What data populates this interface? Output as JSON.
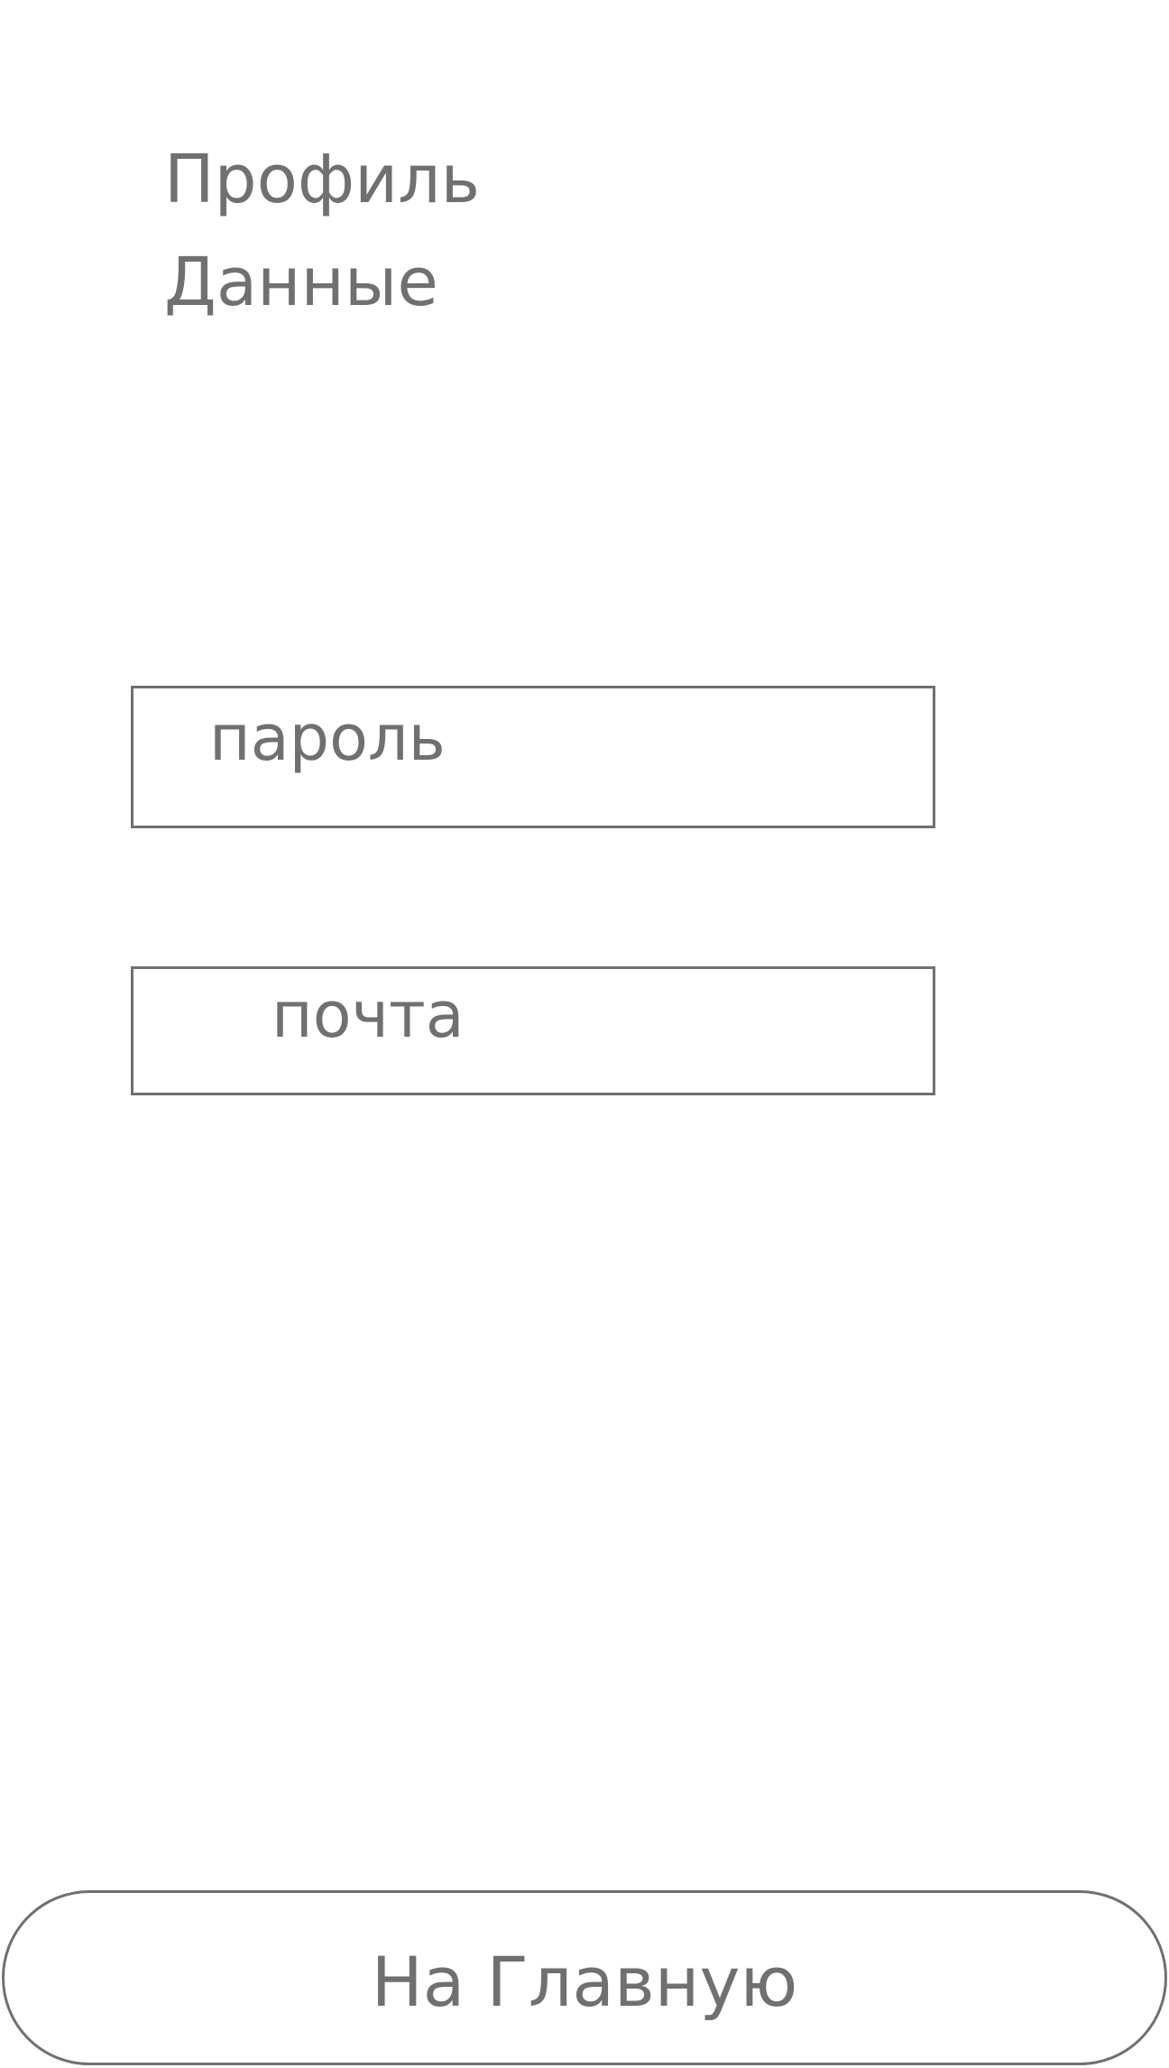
{
  "header": {
    "title": "Профиль",
    "subtitle": "Данные"
  },
  "form": {
    "password_label": "пароль",
    "email_label": "почта"
  },
  "footer": {
    "home_button_label": "На Главную"
  },
  "colors": {
    "text": "#707070",
    "border": "#707070",
    "background": "#ffffff"
  }
}
